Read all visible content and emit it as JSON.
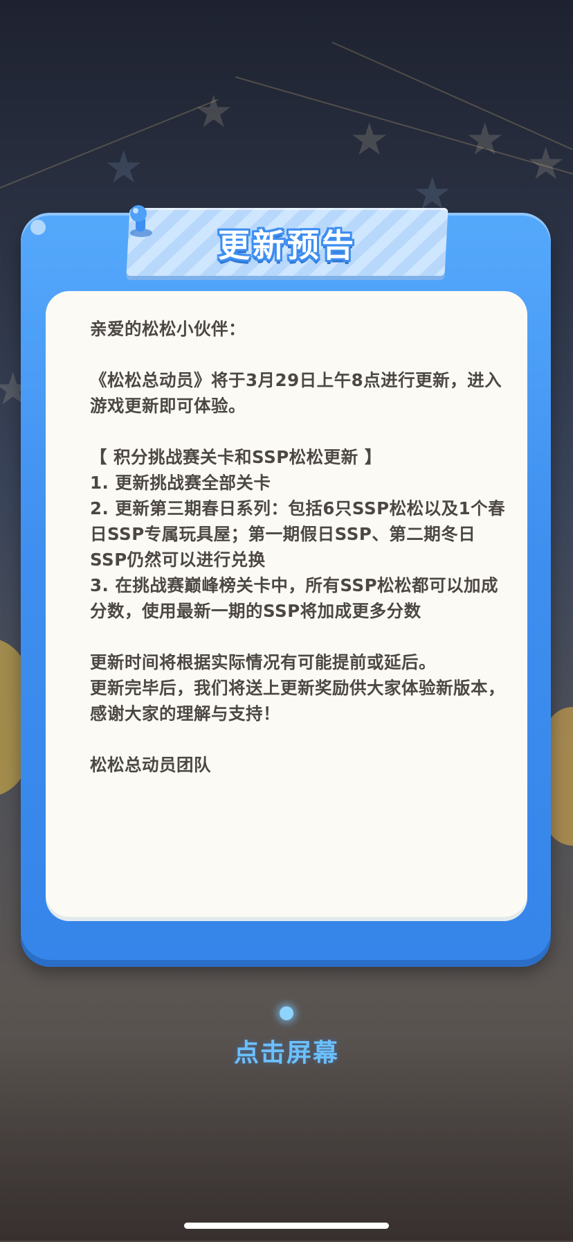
{
  "dialog": {
    "title": "更新预告",
    "greeting": "亲爱的松松小伙伴：",
    "intro": "《松松总动员》将于3月29日上午8点进行更新，进入游戏更新即可体验。",
    "section_header": "【 积分挑战赛关卡和SSP松松更新 】",
    "items": [
      "1. 更新挑战赛全部关卡",
      "2. 更新第三期春日系列：包括6只SSP松松以及1个春日SSP专属玩具屋；第一期假日SSP、第二期冬日SSP仍然可以进行兑换",
      "3. 在挑战赛巅峰榜关卡中，所有SSP松松都可以加成分数，使用最新一期的SSP将加成更多分数"
    ],
    "note_1": "更新时间将根据实际情况有可能提前或延后。",
    "note_2": "更新完毕后，我们将送上更新奖励供大家体验新版本，感谢大家的理解与支持！",
    "signature": "松松总动员团队"
  },
  "tap_prompt": "点击屏幕",
  "colors": {
    "panel_blue": "#3f8ff0",
    "card_bg": "#fbfaf4",
    "tap_text": "#6cc0ff"
  }
}
